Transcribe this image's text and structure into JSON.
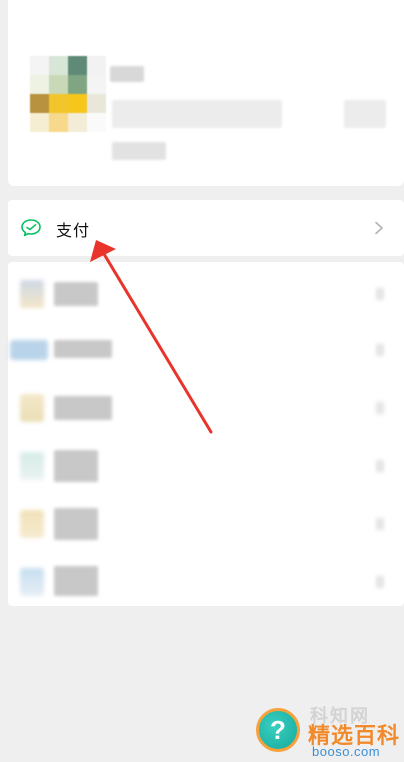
{
  "menu": {
    "pay": {
      "label": "支付",
      "icon": "wechat-pay-icon",
      "accent": "#07c160"
    }
  },
  "watermark": {
    "top_text": "科知网",
    "main_text": "精选百科",
    "url": "booso.com",
    "badge": "?"
  },
  "colors": {
    "background": "#efefef",
    "card": "#ffffff",
    "arrow": "#e8342b",
    "watermark_orange": "#f08a2c",
    "watermark_teal": "#13a89c"
  }
}
